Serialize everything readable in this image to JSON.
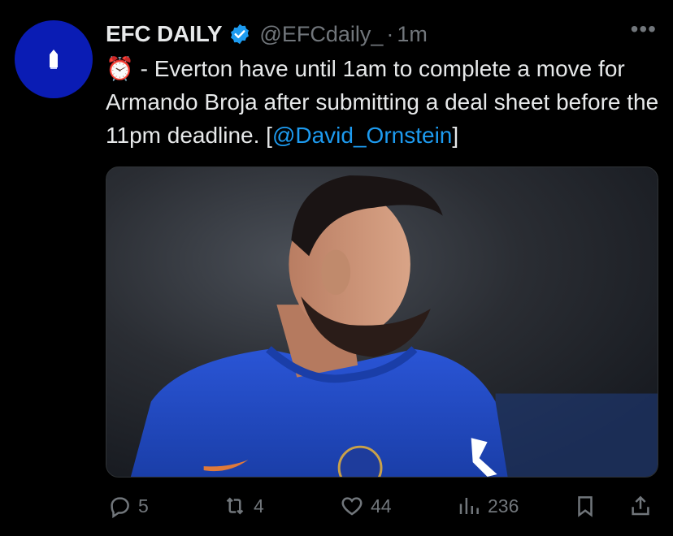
{
  "tweet": {
    "display_name": "EFC DAILY",
    "handle": "@EFCdaily_",
    "separator": "·",
    "time": "1m",
    "more_label": "•••",
    "text_prefix": "⏰ - Everton have until 1am to complete a move for Armando Broja after submitting a deal sheet before the 11pm deadline. [",
    "mention": "@David_Ornstein",
    "text_suffix": "]",
    "colors": {
      "avatar_bg": "#0a1cb4",
      "verified": "#1d9bf0",
      "link": "#1d9bf0",
      "muted": "#71767b"
    }
  },
  "actions": {
    "replies": "5",
    "retweets": "4",
    "likes": "44",
    "views": "236"
  }
}
